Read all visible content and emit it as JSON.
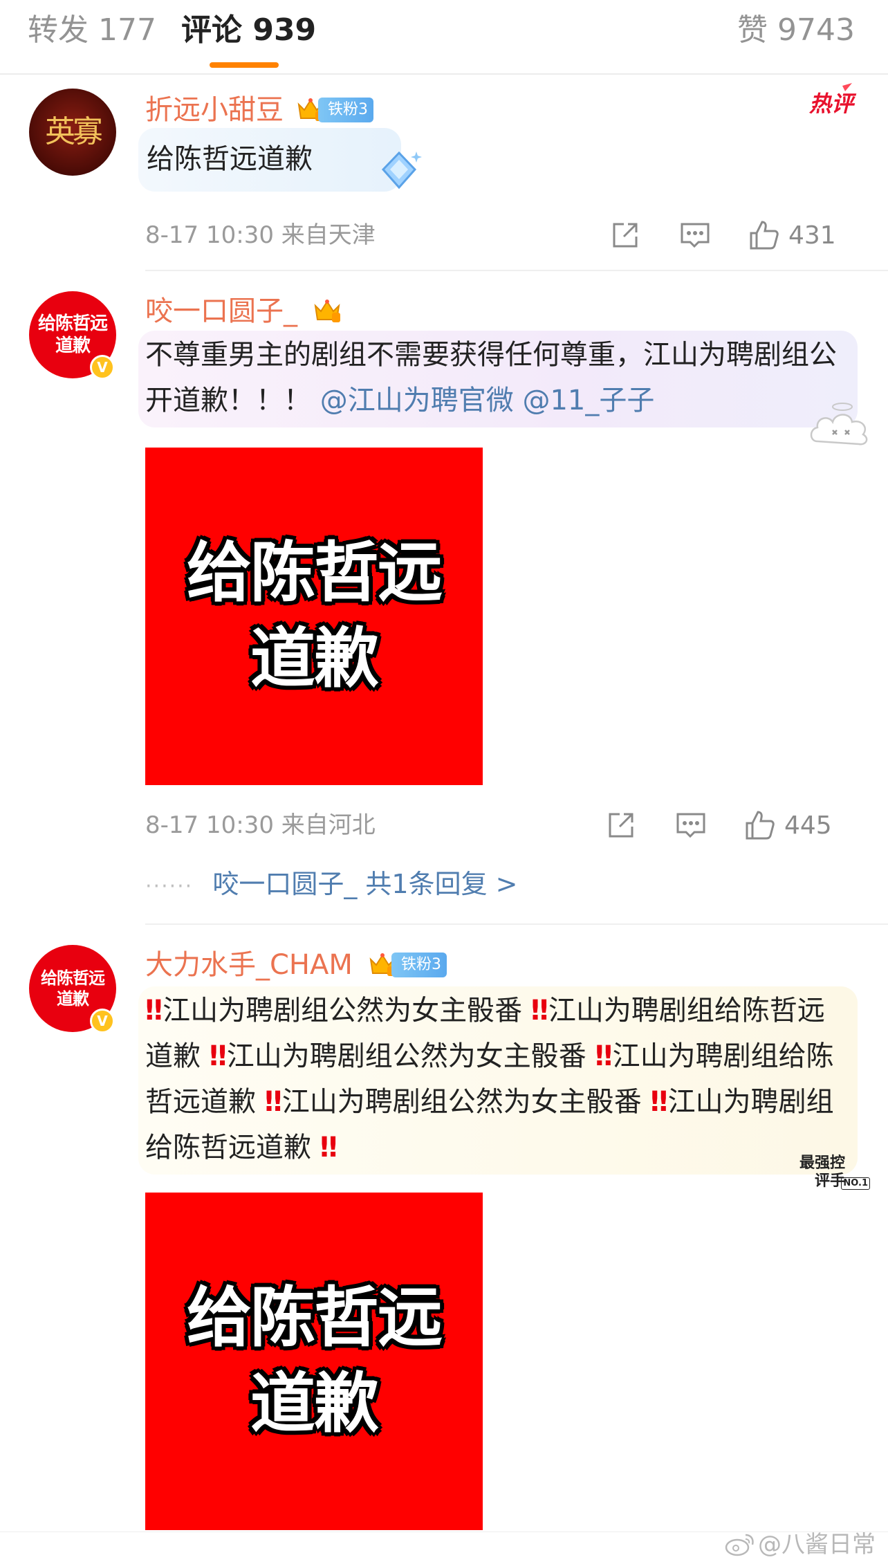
{
  "tabs": {
    "forward": {
      "label": "转发",
      "count": "177"
    },
    "comments": {
      "label": "评论",
      "count": "939"
    },
    "likes": {
      "label": "赞",
      "count": "9743"
    }
  },
  "colors": {
    "accent": "#ff8200",
    "username": "#eb7350",
    "link": "#507daf",
    "image_bg": "#ff0000"
  },
  "comments": [
    {
      "username": "折远小甜豆",
      "fan_badge": "铁粉3",
      "hot_label": "热评",
      "avatar_title": "英寡",
      "text": "给陈哲远道歉",
      "time": "8-17 10:30",
      "location": "来自天津",
      "likes": "431"
    },
    {
      "username": "咬一口圆子_",
      "avatar_text": "给陈哲远道歉",
      "text": "不尊重男主的剧组不需要获得任何尊重，江山为聘剧组公开道歉！！！",
      "mention1": "@江山为聘官微",
      "mention2": "@11_子子",
      "image_text": "给陈哲远道歉",
      "time": "8-17 10:30",
      "location": "来自河北",
      "likes": "445",
      "reply_author": "咬一口圆子_",
      "reply_summary": "共1条回复 >"
    },
    {
      "username": "大力水手_CHAM",
      "fan_badge": "铁粉3",
      "avatar_text": "给陈哲远道歉",
      "text_segments": [
        "江山为聘剧组公然为女主骰番",
        "江山为聘剧组给陈哲远道歉",
        "江山为聘剧组公然为女主骰番",
        "江山为聘剧组给陈哲远道歉",
        "江山为聘剧组公然为女主骰番",
        "江山为聘剧组给陈哲远道歉"
      ],
      "deco_label": "最强控评手",
      "deco_sub": "NO.1",
      "image_text": "给陈哲远道歉"
    }
  ],
  "watermark": "@八酱日常"
}
